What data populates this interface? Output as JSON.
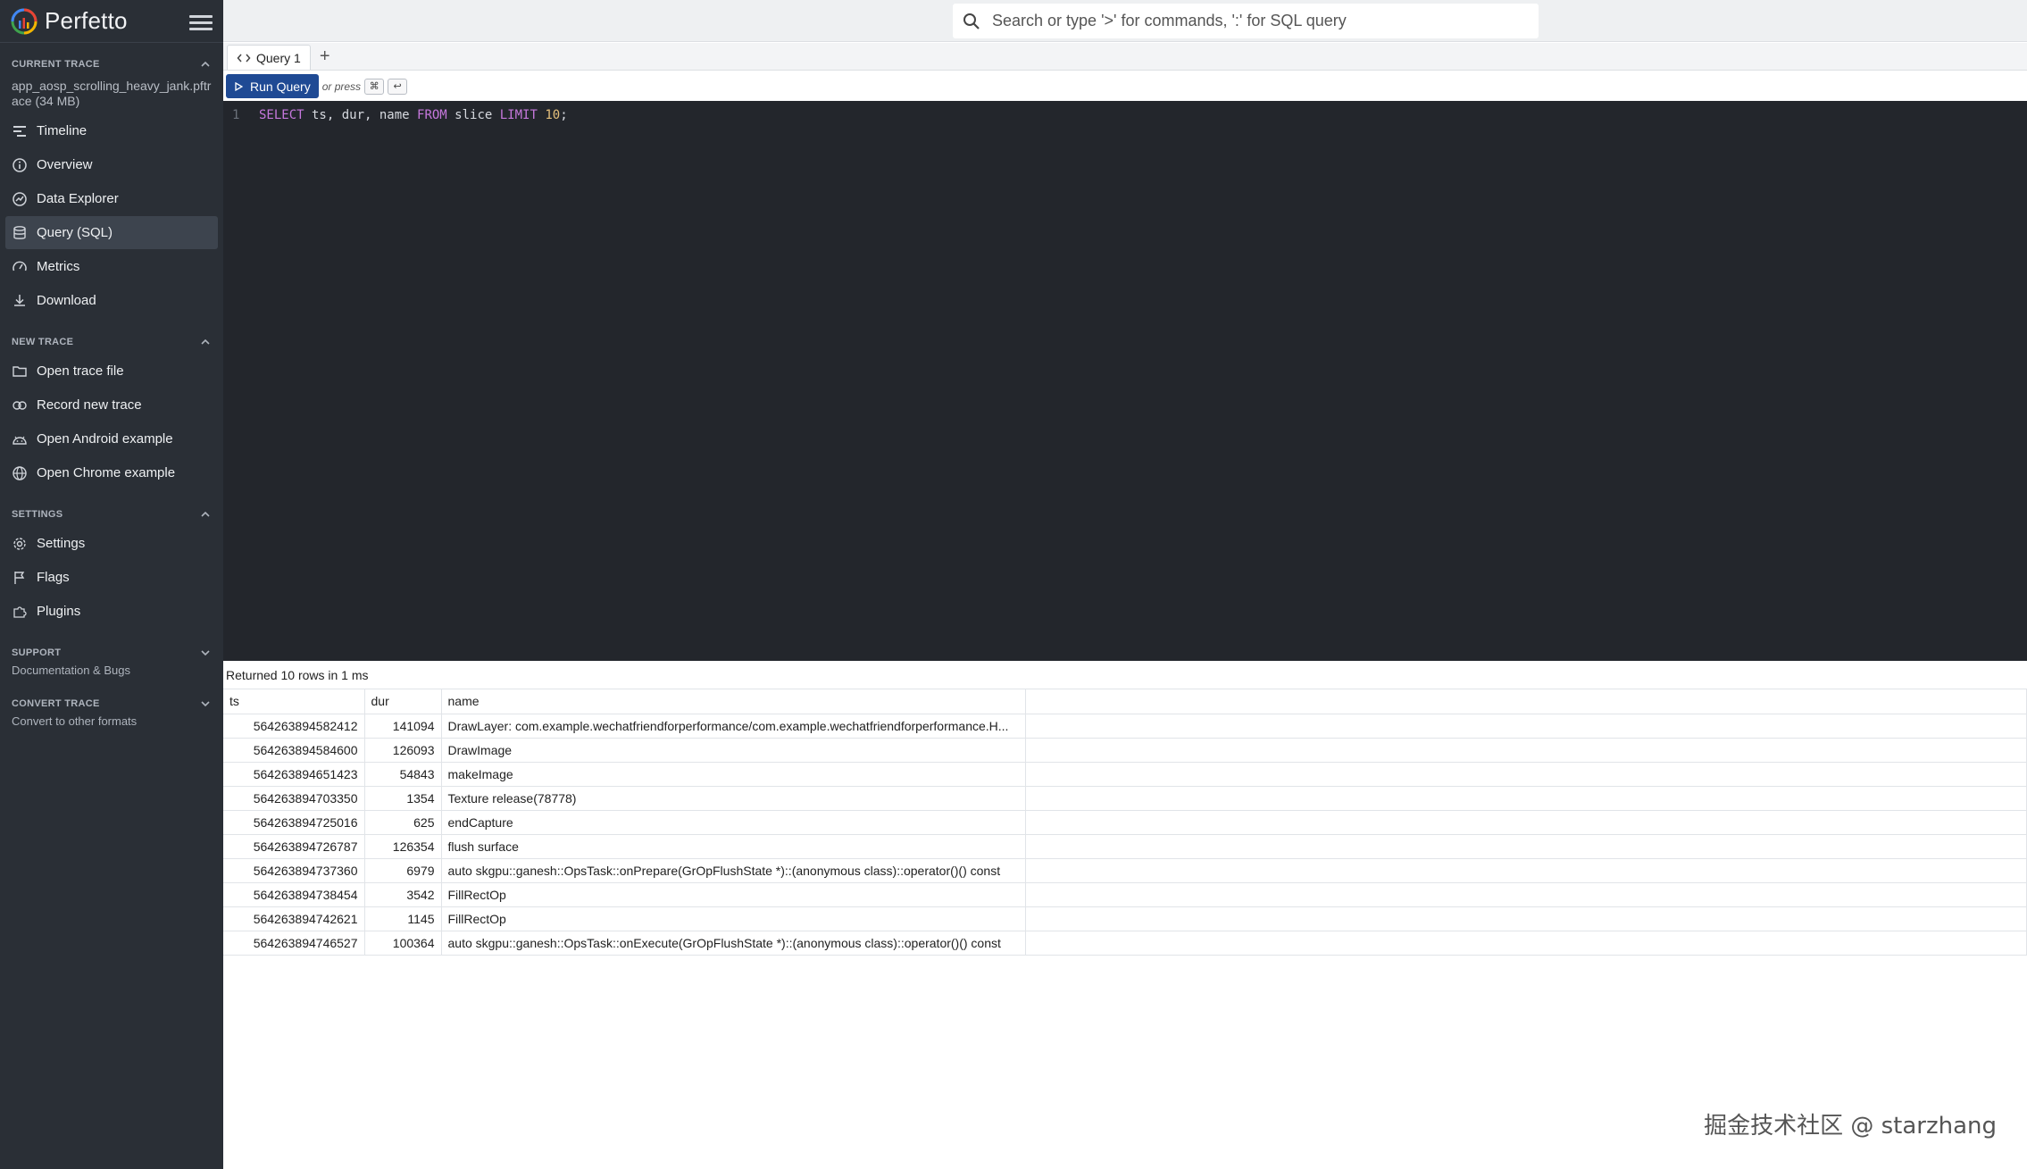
{
  "app": {
    "title": "Perfetto"
  },
  "colors": {
    "sidebar_bg": "#2a2f36",
    "accent": "#1f4a94",
    "editor_bg": "#23262c",
    "keyword": "#c678dd",
    "number": "#e5c07b"
  },
  "search": {
    "placeholder": "Search or type '>' for commands, ':' for SQL query",
    "value": ""
  },
  "sidebar": {
    "current_trace": {
      "header": "CURRENT TRACE",
      "trace_name": "app_aosp_scrolling_heavy_jank.pftrace (34 MB)",
      "items": [
        {
          "label": "Timeline",
          "icon": "timeline-icon"
        },
        {
          "label": "Overview",
          "icon": "info-icon"
        },
        {
          "label": "Data Explorer",
          "icon": "explore-icon"
        },
        {
          "label": "Query (SQL)",
          "icon": "database-icon",
          "active": true
        },
        {
          "label": "Metrics",
          "icon": "speedometer-icon"
        },
        {
          "label": "Download",
          "icon": "download-icon"
        }
      ]
    },
    "new_trace": {
      "header": "NEW TRACE",
      "items": [
        {
          "label": "Open trace file",
          "icon": "folder-icon"
        },
        {
          "label": "Record new trace",
          "icon": "record-icon"
        },
        {
          "label": "Open Android example",
          "icon": "android-icon"
        },
        {
          "label": "Open Chrome example",
          "icon": "globe-icon"
        }
      ]
    },
    "settings": {
      "header": "SETTINGS",
      "items": [
        {
          "label": "Settings",
          "icon": "gear-icon"
        },
        {
          "label": "Flags",
          "icon": "flag-icon"
        },
        {
          "label": "Plugins",
          "icon": "puzzle-icon"
        }
      ]
    },
    "support": {
      "header": "SUPPORT",
      "subtitle": "Documentation & Bugs"
    },
    "convert_trace": {
      "header": "CONVERT TRACE",
      "subtitle": "Convert to other formats"
    }
  },
  "tabs": [
    {
      "label": "Query 1"
    }
  ],
  "tab_add_label": "+",
  "toolbar": {
    "run_label": "Run Query",
    "or_press": "or press",
    "key1": "⌘",
    "key2": "↩"
  },
  "editor": {
    "line_number": "1",
    "tokens": [
      {
        "t": "SELECT",
        "k": "kw"
      },
      {
        "t": " ts, dur, name ",
        "k": "plain"
      },
      {
        "t": "FROM",
        "k": "kw"
      },
      {
        "t": " slice ",
        "k": "plain"
      },
      {
        "t": "LIMIT",
        "k": "kw"
      },
      {
        "t": " ",
        "k": "plain"
      },
      {
        "t": "10",
        "k": "num"
      },
      {
        "t": ";",
        "k": "plain"
      }
    ]
  },
  "results": {
    "status": "Returned 10 rows in 1 ms",
    "columns": [
      "ts",
      "dur",
      "name"
    ],
    "rows": [
      [
        "564263894582412",
        "141094",
        "DrawLayer: com.example.wechatfriendforperformance/com.example.wechatfriendforperformance.H..."
      ],
      [
        "564263894584600",
        "126093",
        "DrawImage"
      ],
      [
        "564263894651423",
        "54843",
        "makeImage"
      ],
      [
        "564263894703350",
        "1354",
        "Texture release(78778)"
      ],
      [
        "564263894725016",
        "625",
        "endCapture"
      ],
      [
        "564263894726787",
        "126354",
        "flush surface"
      ],
      [
        "564263894737360",
        "6979",
        "auto skgpu::ganesh::OpsTask::onPrepare(GrOpFlushState *)::(anonymous class)::operator()() const"
      ],
      [
        "564263894738454",
        "3542",
        "FillRectOp"
      ],
      [
        "564263894742621",
        "1145",
        "FillRectOp"
      ],
      [
        "564263894746527",
        "100364",
        "auto skgpu::ganesh::OpsTask::onExecute(GrOpFlushState *)::(anonymous class)::operator()() const"
      ]
    ]
  },
  "watermark": "掘金技术社区 @ starzhang"
}
